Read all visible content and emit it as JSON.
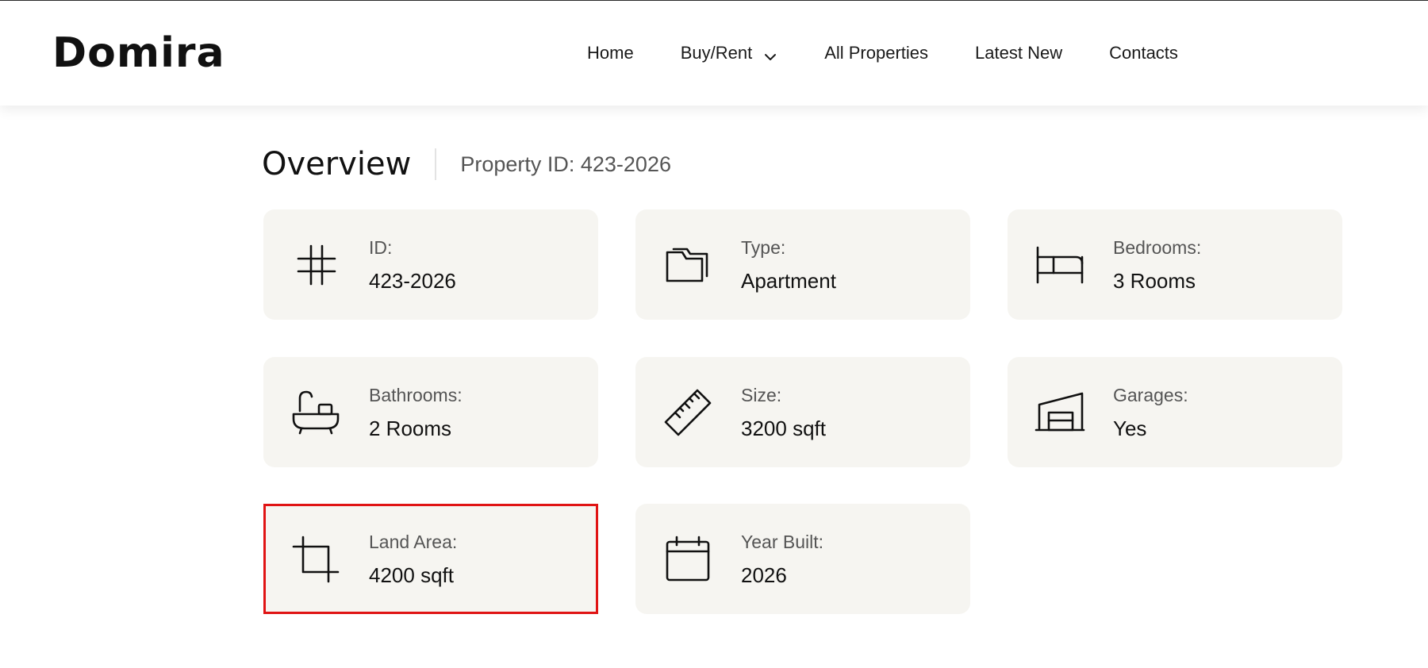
{
  "header": {
    "logo": "Domira",
    "nav": [
      {
        "label": "Home"
      },
      {
        "label": "Buy/Rent",
        "icon": "chevron-down-icon"
      },
      {
        "label": "All Properties"
      },
      {
        "label": "Latest New"
      },
      {
        "label": "Contacts"
      }
    ]
  },
  "overview": {
    "title": "Overview",
    "property_id": "Property ID: 423-2026",
    "cards": [
      {
        "icon": "hash-icon",
        "label": "ID:",
        "value": "423-2026"
      },
      {
        "icon": "folder-icon",
        "label": "Type:",
        "value": "Apartment"
      },
      {
        "icon": "bed-icon",
        "label": "Bedrooms:",
        "value": "3 Rooms"
      },
      {
        "icon": "bathtub-icon",
        "label": "Bathrooms:",
        "value": "2 Rooms"
      },
      {
        "icon": "ruler-icon",
        "label": "Size:",
        "value": "3200 sqft"
      },
      {
        "icon": "garage-icon",
        "label": "Garages:",
        "value": "Yes"
      },
      {
        "icon": "crop-icon",
        "label": "Land Area:",
        "value": "4200 sqft",
        "highlighted": true
      },
      {
        "icon": "calendar-icon",
        "label": "Year Built:",
        "value": "2026"
      }
    ]
  },
  "colors": {
    "card_bg": "#f6f5f1",
    "highlight_border": "#e01414",
    "text_primary": "#111111",
    "text_secondary": "#555555"
  }
}
